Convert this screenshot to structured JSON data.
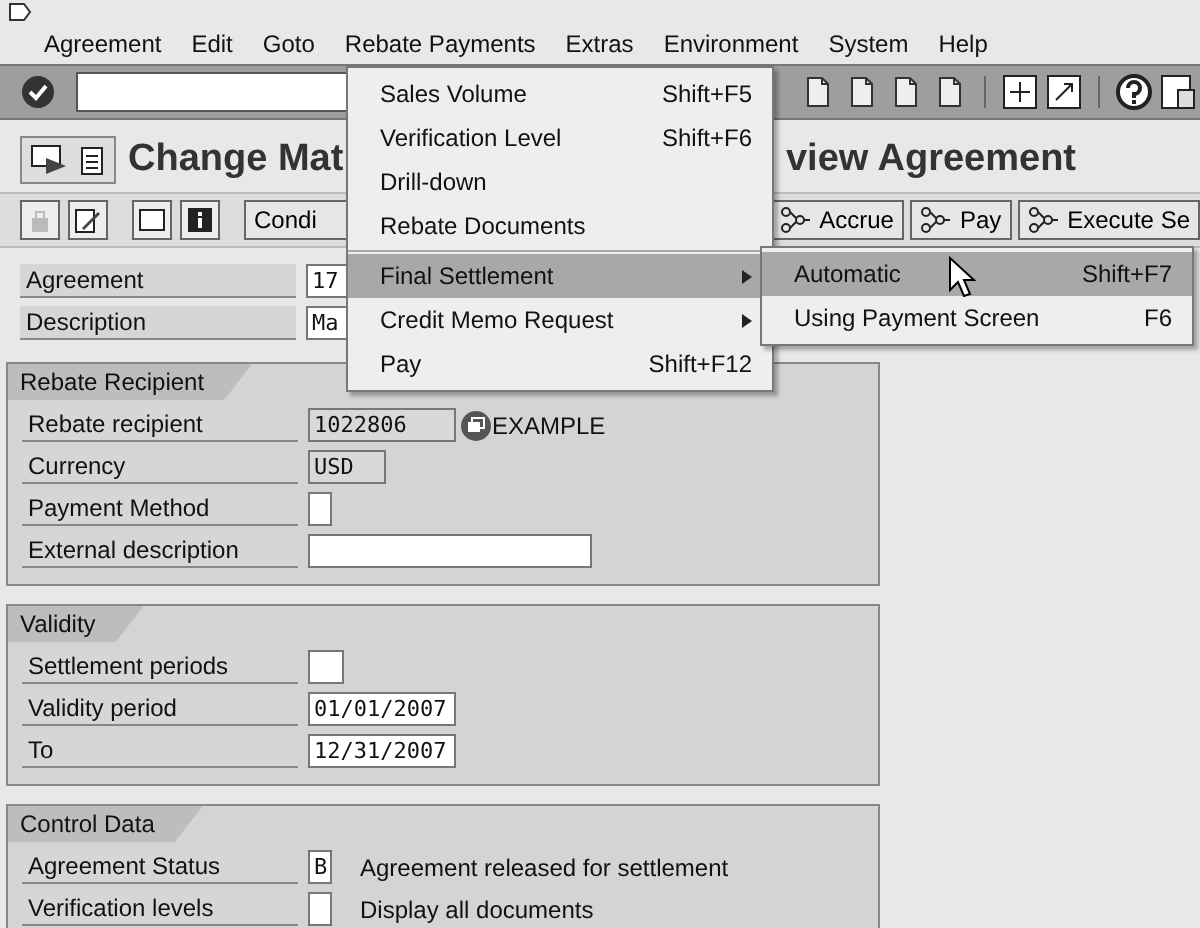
{
  "menu_bar": [
    {
      "label": "Agreement"
    },
    {
      "label": "Edit"
    },
    {
      "label": "Goto"
    },
    {
      "label": "Rebate Payments"
    },
    {
      "label": "Extras"
    },
    {
      "label": "Environment"
    },
    {
      "label": "System"
    },
    {
      "label": "Help"
    }
  ],
  "title_parts": [
    "Change Mat",
    "view Agreement"
  ],
  "app_toolbar": {
    "left_button": "Condi",
    "buttons": [
      "Accrue",
      "Pay",
      "Execute Se"
    ]
  },
  "header_fields": [
    {
      "label": "Agreement",
      "value": "17"
    },
    {
      "label": "Description",
      "value": "Ma"
    }
  ],
  "groups": [
    {
      "title": "Rebate Recipient",
      "fields": [
        {
          "label": "Rebate recipient",
          "value": "1022806",
          "kind": "display",
          "note": "EXAMPLE",
          "lookup": true
        },
        {
          "label": "Currency",
          "value": "USD",
          "kind": "display"
        },
        {
          "label": "Payment Method",
          "kind": "input"
        },
        {
          "label": "External description",
          "kind": "input"
        }
      ]
    },
    {
      "title": "Validity",
      "fields": [
        {
          "label": "Settlement periods",
          "kind": "input"
        },
        {
          "label": "Validity period",
          "value": "01/01/2007",
          "kind": "input"
        },
        {
          "label": "To",
          "value": "12/31/2007",
          "kind": "input"
        }
      ]
    },
    {
      "title": "Control Data",
      "fields": [
        {
          "label": "Agreement Status",
          "value": "B",
          "kind": "input",
          "note": "Agreement released for settlement"
        },
        {
          "label": "Verification levels",
          "kind": "input",
          "note": "Display all documents"
        }
      ]
    }
  ],
  "dropdown_menu": [
    {
      "label": "Sales Volume",
      "shortcut": "Shift+F5",
      "submenu": false,
      "selected": false
    },
    {
      "label": "Verification Level",
      "shortcut": "Shift+F6",
      "submenu": false,
      "selected": false
    },
    {
      "label": "Drill-down",
      "submenu": false,
      "selected": false
    },
    {
      "label": "Rebate Documents",
      "submenu": false,
      "selected": false
    },
    {
      "label": "Final Settlement",
      "submenu": true,
      "selected": true
    },
    {
      "label": "Credit Memo Request",
      "submenu": true,
      "selected": false
    },
    {
      "label": "Pay",
      "shortcut": "Shift+F12",
      "submenu": false,
      "selected": false
    }
  ],
  "submenu": [
    {
      "label": "Automatic",
      "shortcut": "Shift+F7",
      "selected": true
    },
    {
      "label": "Using Payment Screen",
      "shortcut": "F6",
      "selected": false
    }
  ]
}
